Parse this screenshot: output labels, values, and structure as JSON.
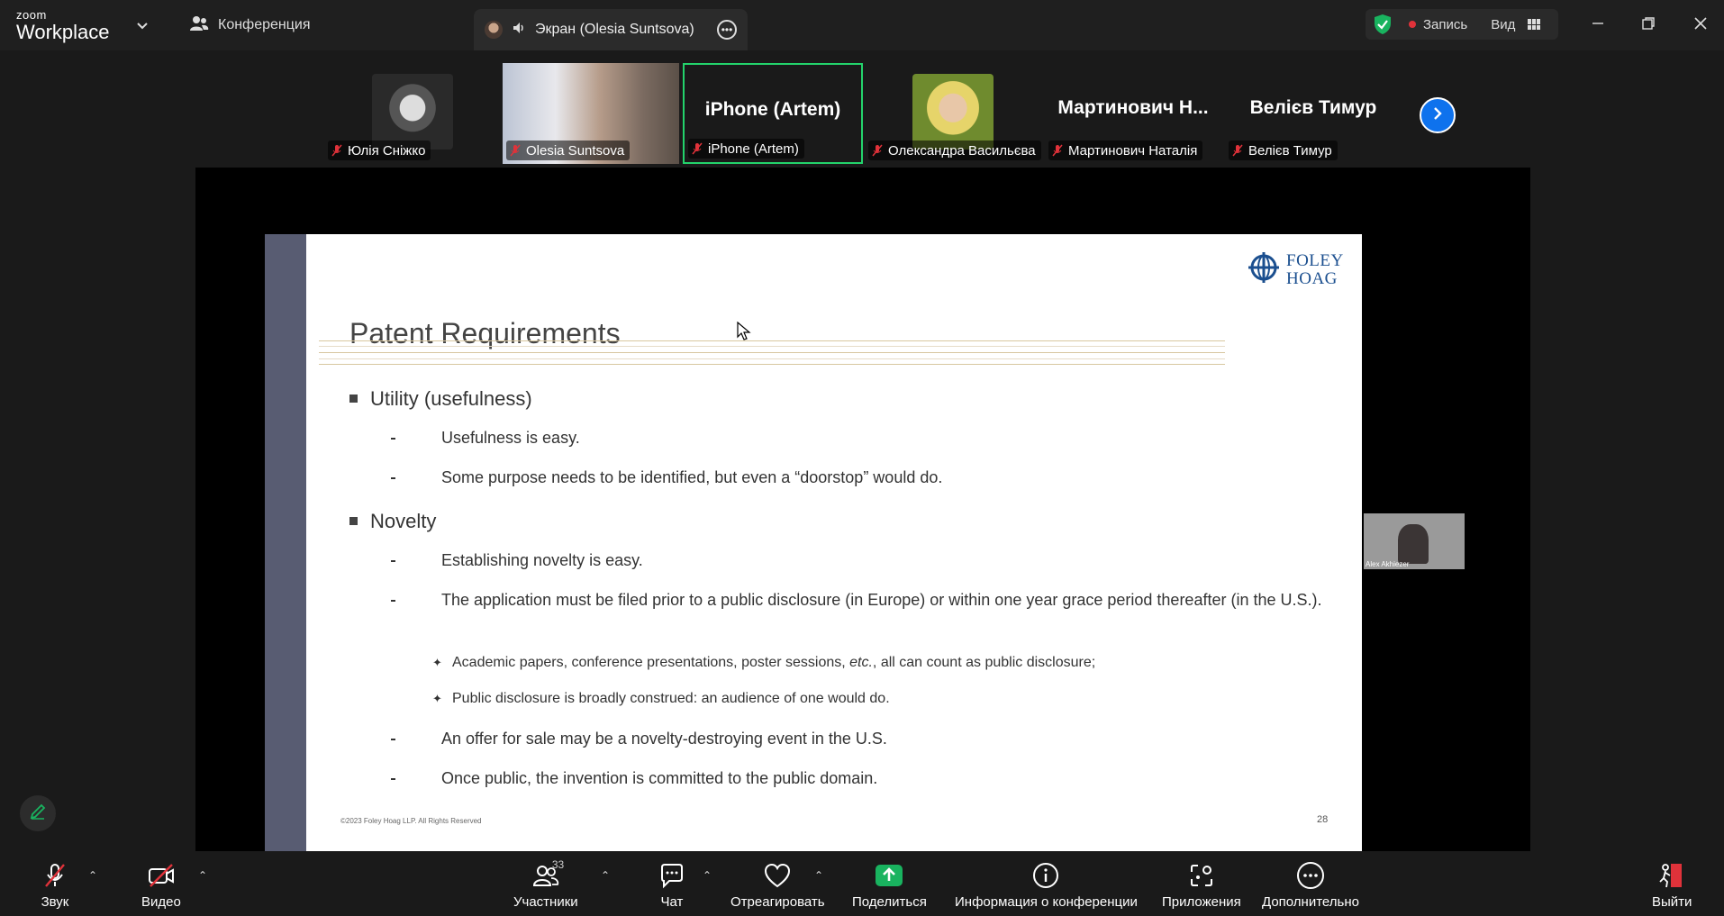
{
  "app": {
    "brand_top": "zoom",
    "brand_bottom": "Workplace",
    "meeting_tab_label": "Конференция",
    "screen_tab_label": "Экран (Olesia Suntsova)",
    "record_label": "Запись",
    "view_label": "Вид"
  },
  "gallery": {
    "tiles": [
      {
        "name": "Юлія Сніжко",
        "display": ""
      },
      {
        "name": "Olesia Suntsova",
        "display": ""
      },
      {
        "name": "iPhone (Artem)",
        "display": "iPhone (Artem)"
      },
      {
        "name": "Олександра Васильєва",
        "display": ""
      },
      {
        "name": "Мартинович Наталія",
        "display": "Мартинович Н..."
      },
      {
        "name": "Велієв Тимур",
        "display": "Велієв Тимур"
      }
    ]
  },
  "slide": {
    "logo_line1": "FOLEY",
    "logo_line2": "HOAG",
    "title": "Patent Requirements",
    "b1": "Utility (usefulness)",
    "b1_s1": "Usefulness is easy.",
    "b1_s2": "Some purpose needs to be identified, but even a “doorstop” would do.",
    "b2": "Novelty",
    "b2_s1": "Establishing novelty is easy.",
    "b2_s2": "The application must be filed prior to a public disclosure (in Europe) or within one year grace period thereafter (in the U.S.).",
    "b2_s2_t1_pre": "Academic papers, conference presentations, poster sessions, ",
    "b2_s2_t1_em": "etc.",
    "b2_s2_t1_post": ", all can count as public disclosure;",
    "b2_s2_t2": "Public disclosure is broadly construed: an audience of one would do.",
    "b2_s3": "An offer for sale may be a novelty-destroying event in the U.S.",
    "b2_s4": "Once public, the invention is committed to the public domain.",
    "footer": "©2023 Foley Hoag LLP. All Rights Reserved",
    "page_number": "28"
  },
  "self_view": {
    "name": "Alex Akhiezer"
  },
  "toolbar": {
    "audio": "Звук",
    "video": "Видео",
    "participants": "Участники",
    "participants_count": "33",
    "chat": "Чат",
    "react": "Отреагировать",
    "share": "Поделиться",
    "info": "Информация о конференции",
    "apps": "Приложения",
    "more": "Дополнительно",
    "leave": "Выйти"
  },
  "colors": {
    "accent_blue": "#0e72ed",
    "share_green": "#19b35f",
    "active_speaker": "#23d36b",
    "leave_red": "#e0323a",
    "slide_sidebar": "#585c72",
    "foley_blue": "#1b4f8f"
  },
  "icons": [
    "chevron-down-icon",
    "participants-icon",
    "speaker-icon",
    "more-icon",
    "shield-icon",
    "grid-icon",
    "minimize-icon",
    "restore-icon",
    "close-icon",
    "mic-off-icon",
    "chevron-right-icon",
    "pencil-icon",
    "video-off-icon",
    "chat-icon",
    "heart-icon",
    "share-arrow-icon",
    "info-icon",
    "apps-icon",
    "ellipsis-icon",
    "leave-door-icon",
    "cursor-icon",
    "foley-hoag-logo-icon"
  ]
}
